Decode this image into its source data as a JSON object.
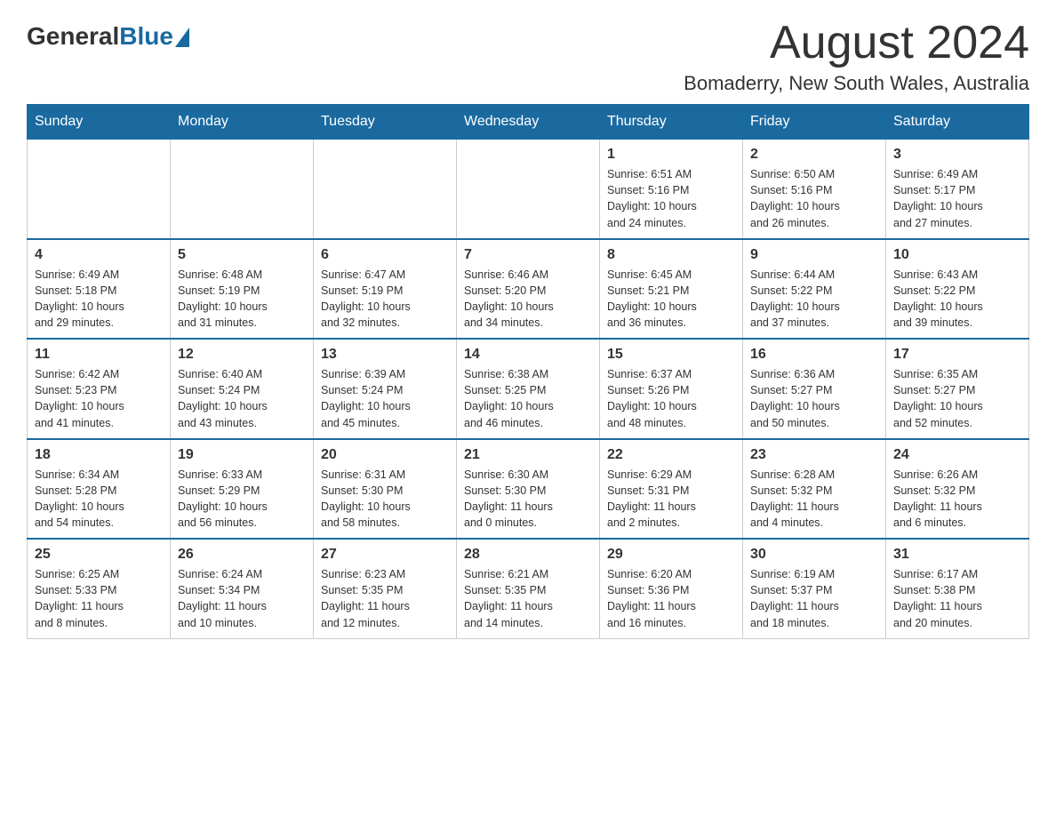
{
  "header": {
    "logo_general": "General",
    "logo_blue": "Blue",
    "title": "August 2024",
    "subtitle": "Bomaderry, New South Wales, Australia"
  },
  "days_of_week": [
    "Sunday",
    "Monday",
    "Tuesday",
    "Wednesday",
    "Thursday",
    "Friday",
    "Saturday"
  ],
  "weeks": [
    {
      "days": [
        {
          "number": "",
          "info": ""
        },
        {
          "number": "",
          "info": ""
        },
        {
          "number": "",
          "info": ""
        },
        {
          "number": "",
          "info": ""
        },
        {
          "number": "1",
          "info": "Sunrise: 6:51 AM\nSunset: 5:16 PM\nDaylight: 10 hours\nand 24 minutes."
        },
        {
          "number": "2",
          "info": "Sunrise: 6:50 AM\nSunset: 5:16 PM\nDaylight: 10 hours\nand 26 minutes."
        },
        {
          "number": "3",
          "info": "Sunrise: 6:49 AM\nSunset: 5:17 PM\nDaylight: 10 hours\nand 27 minutes."
        }
      ]
    },
    {
      "days": [
        {
          "number": "4",
          "info": "Sunrise: 6:49 AM\nSunset: 5:18 PM\nDaylight: 10 hours\nand 29 minutes."
        },
        {
          "number": "5",
          "info": "Sunrise: 6:48 AM\nSunset: 5:19 PM\nDaylight: 10 hours\nand 31 minutes."
        },
        {
          "number": "6",
          "info": "Sunrise: 6:47 AM\nSunset: 5:19 PM\nDaylight: 10 hours\nand 32 minutes."
        },
        {
          "number": "7",
          "info": "Sunrise: 6:46 AM\nSunset: 5:20 PM\nDaylight: 10 hours\nand 34 minutes."
        },
        {
          "number": "8",
          "info": "Sunrise: 6:45 AM\nSunset: 5:21 PM\nDaylight: 10 hours\nand 36 minutes."
        },
        {
          "number": "9",
          "info": "Sunrise: 6:44 AM\nSunset: 5:22 PM\nDaylight: 10 hours\nand 37 minutes."
        },
        {
          "number": "10",
          "info": "Sunrise: 6:43 AM\nSunset: 5:22 PM\nDaylight: 10 hours\nand 39 minutes."
        }
      ]
    },
    {
      "days": [
        {
          "number": "11",
          "info": "Sunrise: 6:42 AM\nSunset: 5:23 PM\nDaylight: 10 hours\nand 41 minutes."
        },
        {
          "number": "12",
          "info": "Sunrise: 6:40 AM\nSunset: 5:24 PM\nDaylight: 10 hours\nand 43 minutes."
        },
        {
          "number": "13",
          "info": "Sunrise: 6:39 AM\nSunset: 5:24 PM\nDaylight: 10 hours\nand 45 minutes."
        },
        {
          "number": "14",
          "info": "Sunrise: 6:38 AM\nSunset: 5:25 PM\nDaylight: 10 hours\nand 46 minutes."
        },
        {
          "number": "15",
          "info": "Sunrise: 6:37 AM\nSunset: 5:26 PM\nDaylight: 10 hours\nand 48 minutes."
        },
        {
          "number": "16",
          "info": "Sunrise: 6:36 AM\nSunset: 5:27 PM\nDaylight: 10 hours\nand 50 minutes."
        },
        {
          "number": "17",
          "info": "Sunrise: 6:35 AM\nSunset: 5:27 PM\nDaylight: 10 hours\nand 52 minutes."
        }
      ]
    },
    {
      "days": [
        {
          "number": "18",
          "info": "Sunrise: 6:34 AM\nSunset: 5:28 PM\nDaylight: 10 hours\nand 54 minutes."
        },
        {
          "number": "19",
          "info": "Sunrise: 6:33 AM\nSunset: 5:29 PM\nDaylight: 10 hours\nand 56 minutes."
        },
        {
          "number": "20",
          "info": "Sunrise: 6:31 AM\nSunset: 5:30 PM\nDaylight: 10 hours\nand 58 minutes."
        },
        {
          "number": "21",
          "info": "Sunrise: 6:30 AM\nSunset: 5:30 PM\nDaylight: 11 hours\nand 0 minutes."
        },
        {
          "number": "22",
          "info": "Sunrise: 6:29 AM\nSunset: 5:31 PM\nDaylight: 11 hours\nand 2 minutes."
        },
        {
          "number": "23",
          "info": "Sunrise: 6:28 AM\nSunset: 5:32 PM\nDaylight: 11 hours\nand 4 minutes."
        },
        {
          "number": "24",
          "info": "Sunrise: 6:26 AM\nSunset: 5:32 PM\nDaylight: 11 hours\nand 6 minutes."
        }
      ]
    },
    {
      "days": [
        {
          "number": "25",
          "info": "Sunrise: 6:25 AM\nSunset: 5:33 PM\nDaylight: 11 hours\nand 8 minutes."
        },
        {
          "number": "26",
          "info": "Sunrise: 6:24 AM\nSunset: 5:34 PM\nDaylight: 11 hours\nand 10 minutes."
        },
        {
          "number": "27",
          "info": "Sunrise: 6:23 AM\nSunset: 5:35 PM\nDaylight: 11 hours\nand 12 minutes."
        },
        {
          "number": "28",
          "info": "Sunrise: 6:21 AM\nSunset: 5:35 PM\nDaylight: 11 hours\nand 14 minutes."
        },
        {
          "number": "29",
          "info": "Sunrise: 6:20 AM\nSunset: 5:36 PM\nDaylight: 11 hours\nand 16 minutes."
        },
        {
          "number": "30",
          "info": "Sunrise: 6:19 AM\nSunset: 5:37 PM\nDaylight: 11 hours\nand 18 minutes."
        },
        {
          "number": "31",
          "info": "Sunrise: 6:17 AM\nSunset: 5:38 PM\nDaylight: 11 hours\nand 20 minutes."
        }
      ]
    }
  ]
}
